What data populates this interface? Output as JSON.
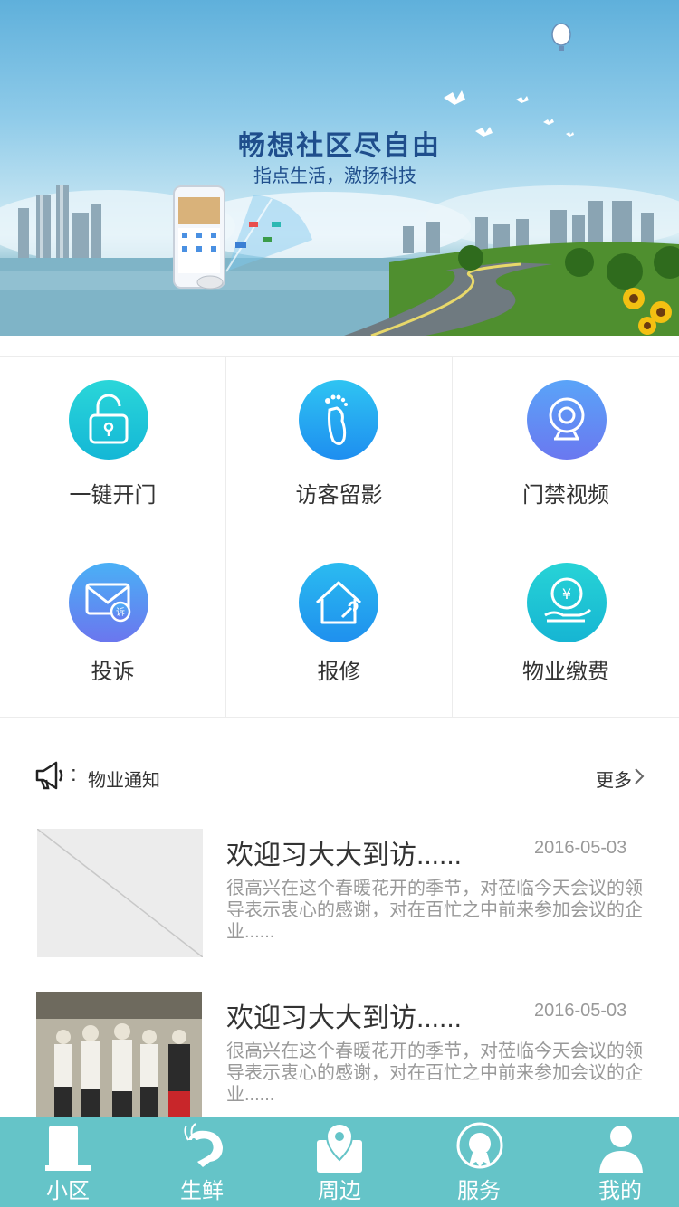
{
  "banner": {
    "title": "畅想社区尽自由",
    "subtitle": "指点生活，激扬科技"
  },
  "features": [
    {
      "label": "一键开门",
      "icon": "unlock-icon",
      "color_top": "#2ad6d9",
      "color_bottom": "#14b7d6"
    },
    {
      "label": "访客留影",
      "icon": "footprint-icon",
      "color_top": "#2fc4f2",
      "color_bottom": "#1e8ef0"
    },
    {
      "label": "门禁视频",
      "icon": "webcam-icon",
      "color_top": "#5aa4f8",
      "color_bottom": "#6a78f0"
    },
    {
      "label": "投诉",
      "icon": "complaint-mail-icon",
      "color_top": "#4ab0f6",
      "color_bottom": "#6b76ee"
    },
    {
      "label": "报修",
      "icon": "repair-house-icon",
      "color_top": "#2bbbf0",
      "color_bottom": "#1f90ee"
    },
    {
      "label": "物业缴费",
      "icon": "payment-hand-icon",
      "color_top": "#27d3d6",
      "color_bottom": "#16b5d3"
    }
  ],
  "notice": {
    "icon": "megaphone-icon",
    "colon": ":",
    "title": "物业通知",
    "more": "更多"
  },
  "news": [
    {
      "title": "欢迎习大大到访......",
      "date": "2016-05-03",
      "body": "很高兴在这个春暖花开的季节，对莅临今天会议的领导表示衷心的感谢，对在百忙之中前来参加会议的企业......",
      "image": "placeholder"
    },
    {
      "title": "欢迎习大大到访......",
      "date": "2016-05-03",
      "body": "很高兴在这个春暖花开的季节，对莅临今天会议的领导表示衷心的感谢，对在百忙之中前来参加会议的企业......",
      "image": "photo"
    }
  ],
  "tabs": [
    {
      "label": "小区",
      "icon": "community-icon"
    },
    {
      "label": "生鲜",
      "icon": "shrimp-icon"
    },
    {
      "label": "周边",
      "icon": "location-pin-icon"
    },
    {
      "label": "服务",
      "icon": "service-badge-icon"
    },
    {
      "label": "我的",
      "icon": "user-icon"
    }
  ],
  "colors": {
    "tabbar": "#65c4c8",
    "text_primary": "#333333",
    "text_secondary": "#999999"
  }
}
